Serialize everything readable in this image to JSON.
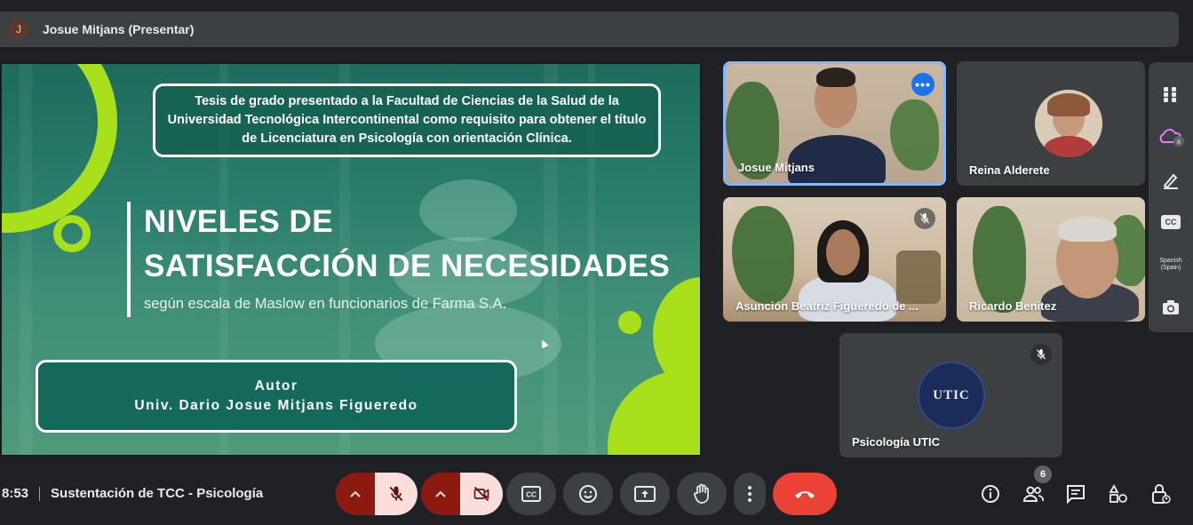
{
  "presenter_bar": {
    "avatar_initial": "J",
    "label": "Josue Mitjans (Presentar)"
  },
  "slide": {
    "tesis_text": "Tesis de grado presentado a la Facultad de Ciencias de la Salud de la Universidad Tecnológica Intercontinental como requisito para obtener el título de Licenciatura en Psicología con orientación Clínica.",
    "title_line1": "NIVELES DE",
    "title_line2": "SATISFACCIÓN DE NECESIDADES",
    "subtitle": "según escala de Maslow en funcionarios de Farma S.A.",
    "autor_label": "Autor",
    "autor_name": "Univ. Dario Josue Mitjans Figueredo",
    "accent_color": "#a8e01b"
  },
  "participants": [
    {
      "name": "Josue Mitjans",
      "active_speaker": true,
      "muted": false,
      "more_options": "•••"
    },
    {
      "name": "Reina Alderete",
      "active_speaker": false,
      "muted": false
    },
    {
      "name": "Asunción Beatriz Figueredo de ...",
      "active_speaker": false,
      "muted": true
    },
    {
      "name": "Ricardo Benitez",
      "active_speaker": false,
      "muted": false
    },
    {
      "name": "Psicología UTIC",
      "active_speaker": false,
      "muted": true,
      "logo_text": "UTIC"
    }
  ],
  "side_panel": {
    "items": [
      {
        "icon": "apps-grid-icon"
      },
      {
        "icon": "weather-cloud-icon"
      },
      {
        "icon": "highlighter-icon"
      },
      {
        "icon": "closed-captions-icon",
        "text": "CC"
      },
      {
        "icon": "language-label",
        "text": "Spanish (Spain)"
      },
      {
        "icon": "camera-icon"
      }
    ]
  },
  "bottom_bar": {
    "time": "8:53",
    "meeting_title": "Sustentación de TCC - Psicología",
    "people_count": "6",
    "end_call_color": "#ea4335",
    "muted_color": "#f9dedc"
  }
}
